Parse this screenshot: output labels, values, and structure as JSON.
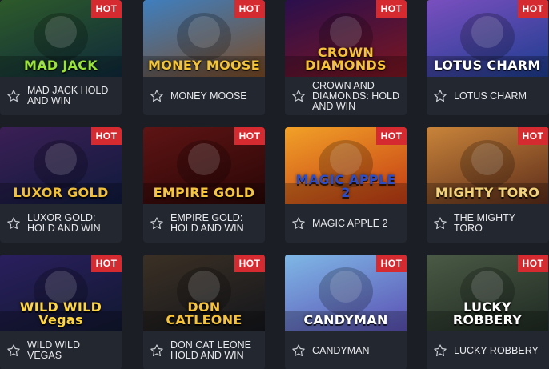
{
  "badge_label": "HOT",
  "games": [
    {
      "title": "MAD JACK HOLD AND WIN",
      "logo": "MAD JACK",
      "bg": "#2d5a2a",
      "bg2": "#0f2a3b",
      "logo_color": "#9be23a",
      "favorite_icon": "star-outline-icon"
    },
    {
      "title": "MONEY MOOSE",
      "logo": "MONEY MOOSE",
      "bg": "#3f7fbf",
      "bg2": "#7b4b25",
      "logo_color": "#f3c338",
      "favorite_icon": "star-outline-icon"
    },
    {
      "title": "CROWN AND DIAMONDS: HOLD AND WIN",
      "logo": "CROWN DIAMONDS",
      "bg": "#2a0f4d",
      "bg2": "#7d1620",
      "logo_color": "#f5c23a",
      "favorite_icon": "star-outline-icon"
    },
    {
      "title": "LOTUS CHARM",
      "logo": "LOTUS CHARM",
      "bg": "#7a4fbf",
      "bg2": "#1d3d8f",
      "logo_color": "#ffffff",
      "favorite_icon": "star-outline-icon"
    },
    {
      "title": "LUXOR GOLD: HOLD AND WIN",
      "logo": "LUXOR GOLD",
      "bg": "#3b1f55",
      "bg2": "#0f1a3d",
      "logo_color": "#f0c03a",
      "favorite_icon": "star-outline-icon"
    },
    {
      "title": "EMPIRE GOLD: HOLD AND WIN",
      "logo": "EMPIRE GOLD",
      "bg": "#5e1414",
      "bg2": "#2a0606",
      "logo_color": "#f5c540",
      "favorite_icon": "star-outline-icon"
    },
    {
      "title": "MAGIC APPLE 2",
      "logo": "MAGIC APPLE 2",
      "bg": "#f2a128",
      "bg2": "#c23a14",
      "logo_color": "#2b4ec8",
      "favorite_icon": "star-outline-icon"
    },
    {
      "title": "THE MIGHTY TORO",
      "logo": "MIGHTY TORO",
      "bg": "#c9843a",
      "bg2": "#5b2c1a",
      "logo_color": "#f2d37a",
      "favorite_icon": "star-outline-icon"
    },
    {
      "title": "WILD WILD VEGAS",
      "logo": "WILD WILD Vegas",
      "bg": "#2a1f5e",
      "bg2": "#111830",
      "logo_color": "#ffd640",
      "favorite_icon": "star-outline-icon"
    },
    {
      "title": "DON CAT LEONE HOLD AND WIN",
      "logo": "DON CATLEONE",
      "bg": "#3b3024",
      "bg2": "#14161c",
      "logo_color": "#f6c339",
      "favorite_icon": "star-outline-icon"
    },
    {
      "title": "CANDYMAN",
      "logo": "CANDYMAN",
      "bg": "#7fb8e6",
      "bg2": "#5a4fb3",
      "logo_color": "#ffffff",
      "favorite_icon": "star-outline-icon"
    },
    {
      "title": "LUCKY ROBBERY",
      "logo": "LUCKY ROBBERY",
      "bg": "#4a5a45",
      "bg2": "#1f2a22",
      "logo_color": "#ffffff",
      "favorite_icon": "star-outline-icon"
    }
  ]
}
